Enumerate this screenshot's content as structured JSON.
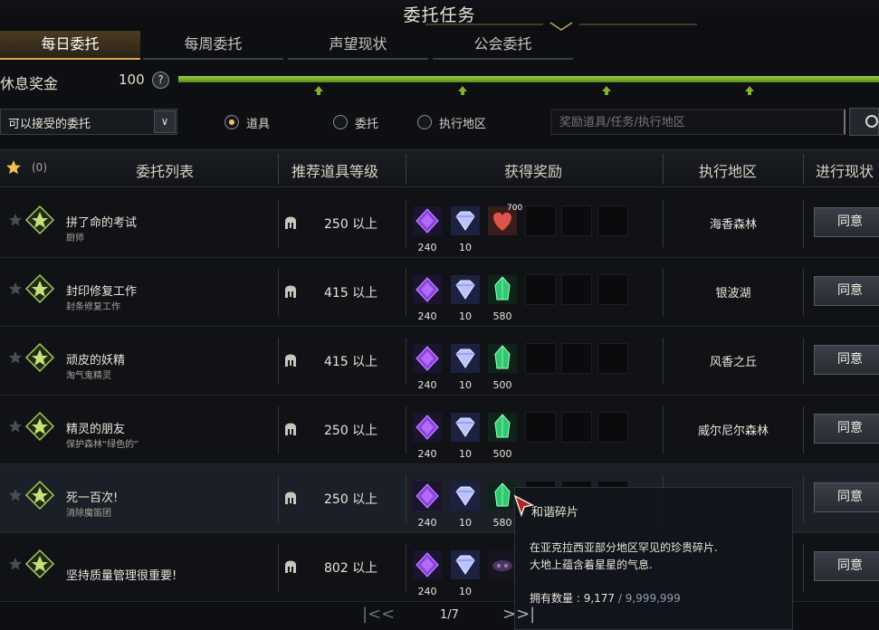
{
  "window": {
    "title": "委托任务"
  },
  "tabs": [
    {
      "label": "每日委托",
      "active": true
    },
    {
      "label": "每周委托",
      "active": false
    },
    {
      "label": "声望现状",
      "active": false
    },
    {
      "label": "公会委托",
      "active": false
    }
  ],
  "rest_bonus": {
    "label": "休息奖金",
    "value": "100",
    "help": "?",
    "fill_fraction": 1.0
  },
  "filter": {
    "dropdown_value": "可以接受的委托",
    "radios": [
      {
        "label": "道具",
        "selected": true
      },
      {
        "label": "委托",
        "selected": false
      },
      {
        "label": "执行地区",
        "selected": false
      }
    ],
    "search_placeholder": "奖励道具/任务/执行地区"
  },
  "table": {
    "favorite_count": "(0)",
    "headers": [
      "委托列表",
      "推荐道具等级",
      "获得奖励",
      "执行地区",
      "进行现状"
    ]
  },
  "rows": [
    {
      "title": "拼了命的考试",
      "subtitle": "厨师",
      "level": "250 以上",
      "rewards": [
        "240",
        "10",
        ""
      ],
      "third_badge": "700",
      "third_kind": "heart",
      "region": "海香森林",
      "action": "同意",
      "favorite": false
    },
    {
      "title": "封印修复工作",
      "subtitle": "封条修复工作",
      "level": "415 以上",
      "rewards": [
        "240",
        "10",
        "580"
      ],
      "third_kind": "crystal",
      "region": "银波湖",
      "action": "同意",
      "favorite": false
    },
    {
      "title": "顽皮的妖精",
      "subtitle": "淘气鬼精灵",
      "level": "415 以上",
      "rewards": [
        "240",
        "10",
        "500"
      ],
      "third_kind": "crystal",
      "region": "风香之丘",
      "action": "同意",
      "favorite": false
    },
    {
      "title": "精灵的朋友",
      "subtitle": "保护森林“绿色的”",
      "level": "250 以上",
      "rewards": [
        "240",
        "10",
        "500"
      ],
      "third_kind": "crystal",
      "region": "威尔尼尔森林",
      "action": "同意",
      "favorite": false
    },
    {
      "title": "死一百次!",
      "subtitle": "消除魔笛团",
      "level": "250 以上",
      "rewards": [
        "240",
        "10",
        "580"
      ],
      "third_kind": "crystal",
      "region": "",
      "action": "同意",
      "favorite": false,
      "highlight": true
    },
    {
      "title": "坚持质量管理很重要!",
      "subtitle": "",
      "level": "802 以上",
      "rewards": [
        "240",
        "10",
        ""
      ],
      "third_kind": "dark",
      "region": "",
      "action": "同意",
      "favorite": false
    }
  ],
  "tooltip": {
    "title": "和谐碎片",
    "desc_line1": "在亚克拉西亚部分地区罕见的珍贵碎片.",
    "desc_line2": "大地上蕴含着星星的气息.",
    "own_label": "拥有数量 : ",
    "own_current": "9,177",
    "own_max": " / 9,999,999"
  },
  "pager": {
    "text": "1/7",
    "first": "|<<",
    "next": ">>|"
  },
  "colors": {
    "accent_gold": "#d6a94e",
    "rest_bar": "#7fb32e",
    "purple_gem": "#8d3fe0",
    "green_crystal": "#2fc86e"
  }
}
